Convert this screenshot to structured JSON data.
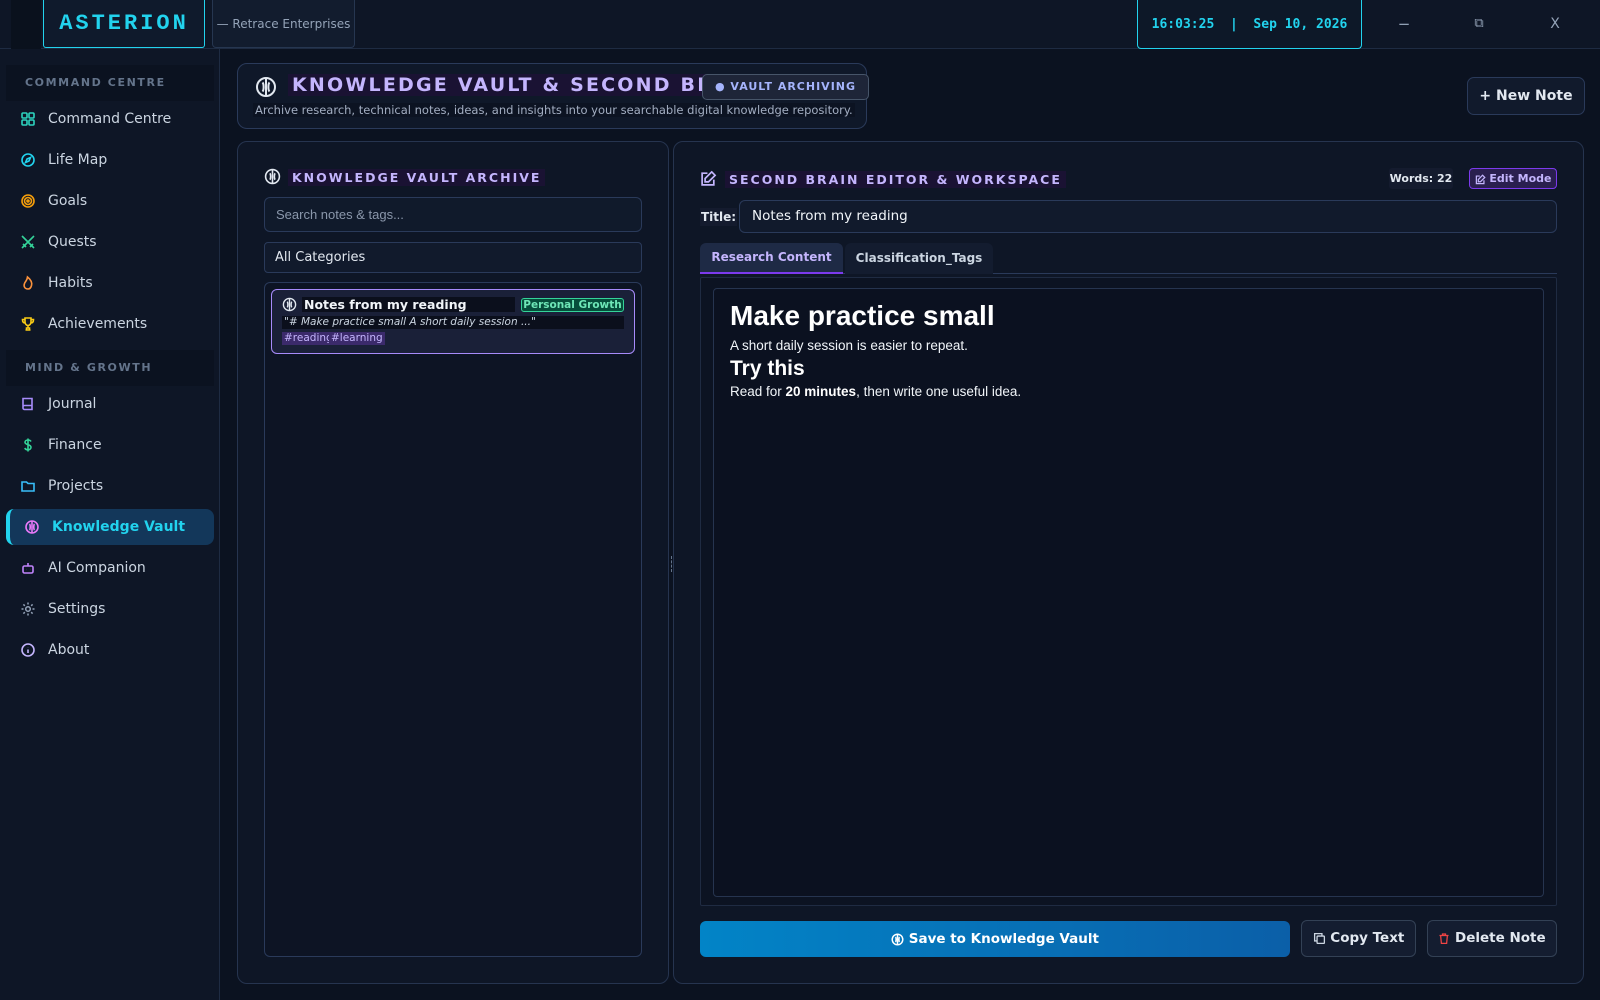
{
  "app": {
    "brand": "ASTERION",
    "company": "— Retrace Enterprises",
    "time": "16:03:25",
    "separator": "|",
    "date": "Sep 10, 2026"
  },
  "window": {
    "minimize_glyph": "−",
    "restore_glyph": "⧉",
    "close_glyph": "X"
  },
  "sidebar": {
    "sections": [
      {
        "label": "COMMAND CENTRE"
      },
      {
        "label": "MIND & GROWTH"
      }
    ],
    "items": [
      {
        "label": "Command Centre",
        "icon": "grid-icon"
      },
      {
        "label": "Life Map",
        "icon": "compass-icon"
      },
      {
        "label": "Goals",
        "icon": "target-icon"
      },
      {
        "label": "Quests",
        "icon": "swords-icon"
      },
      {
        "label": "Habits",
        "icon": "flame-icon"
      },
      {
        "label": "Achievements",
        "icon": "trophy-icon"
      },
      {
        "label": "Journal",
        "icon": "book-icon"
      },
      {
        "label": "Finance",
        "icon": "dollar-icon"
      },
      {
        "label": "Projects",
        "icon": "folder-icon"
      },
      {
        "label": "Knowledge Vault",
        "icon": "brain-icon",
        "active": true
      },
      {
        "label": "AI Companion",
        "icon": "bot-icon"
      },
      {
        "label": "Settings",
        "icon": "gear-icon"
      },
      {
        "label": "About",
        "icon": "info-icon"
      }
    ]
  },
  "header": {
    "title": "KNOWLEDGE VAULT & SECOND BRAIN",
    "badge": "● VAULT ARCHIVING",
    "subtitle": "Archive research, technical notes, ideas, and insights into your searchable digital knowledge repository.",
    "new_note": "+ New Note"
  },
  "archive": {
    "title": "KNOWLEDGE VAULT ARCHIVE",
    "search_placeholder": "Search notes & tags...",
    "category": "All Categories",
    "notes": [
      {
        "title": "Notes from my reading",
        "category": "Personal Growth",
        "snippet": "\"# Make practice small  A short daily session ...\"",
        "tags": [
          "#reading",
          "#learning"
        ]
      }
    ]
  },
  "editor": {
    "title": "SECOND BRAIN EDITOR & WORKSPACE",
    "words": "Words: 22",
    "edit_mode": "Edit Mode",
    "title_label": "Title:",
    "title_value": "Notes from my reading",
    "tabs": [
      {
        "label": "Research Content",
        "active": true
      },
      {
        "label": "Classification_Tags"
      }
    ],
    "content": {
      "h1": "Make practice small",
      "p1": "A short daily session is easier to repeat.",
      "h2": "Try this",
      "p2_before": "Read for ",
      "p2_bold": "20 minutes",
      "p2_after": ", then write one useful idea."
    },
    "save": "Save to Knowledge Vault",
    "copy": "Copy Text",
    "delete": "Delete Note"
  },
  "colors": {
    "accent": "#22d3ee",
    "violet": "#a78bfa",
    "save": "#0284c7",
    "category_green": "#34d399",
    "danger": "#ef4444"
  }
}
